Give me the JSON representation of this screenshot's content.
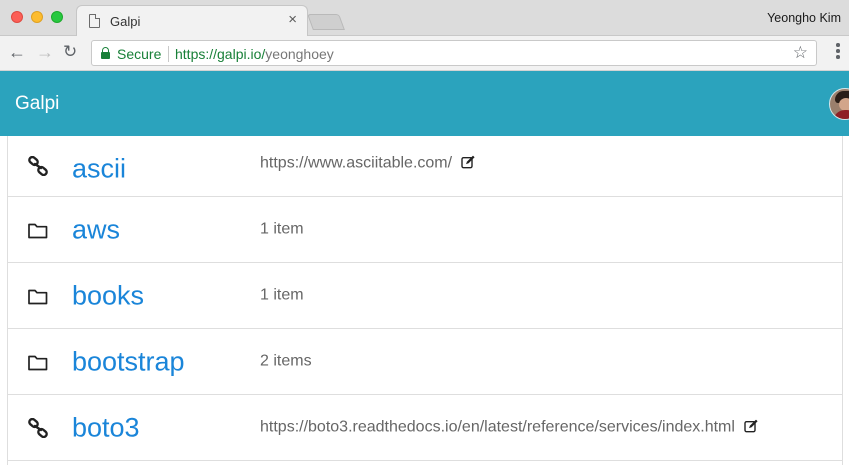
{
  "browser": {
    "tab_title": "Galpi",
    "tab_close": "×",
    "profile_name": "Yeongho Kim",
    "secure_label": "Secure",
    "url_base": "https://galpi.io/",
    "url_path": "yeonghoey"
  },
  "navbar": {
    "brand": "Galpi",
    "color": "#2ba3bd"
  },
  "items": [
    {
      "name": "ascii",
      "type": "link",
      "icon": "link-icon",
      "info": "https://www.asciitable.com/",
      "editable": true
    },
    {
      "name": "aws",
      "type": "folder",
      "icon": "folder-icon",
      "info": "1 item",
      "editable": false
    },
    {
      "name": "books",
      "type": "folder",
      "icon": "folder-icon",
      "info": "1 item",
      "editable": false
    },
    {
      "name": "bootstrap",
      "type": "folder",
      "icon": "folder-icon",
      "info": "2 items",
      "editable": false
    },
    {
      "name": "boto3",
      "type": "link",
      "icon": "link-icon",
      "info": "https://boto3.readthedocs.io/en/latest/reference/services/index.html",
      "editable": true
    }
  ],
  "colors": {
    "accent": "#1a85d9",
    "secure_green": "#188038"
  }
}
